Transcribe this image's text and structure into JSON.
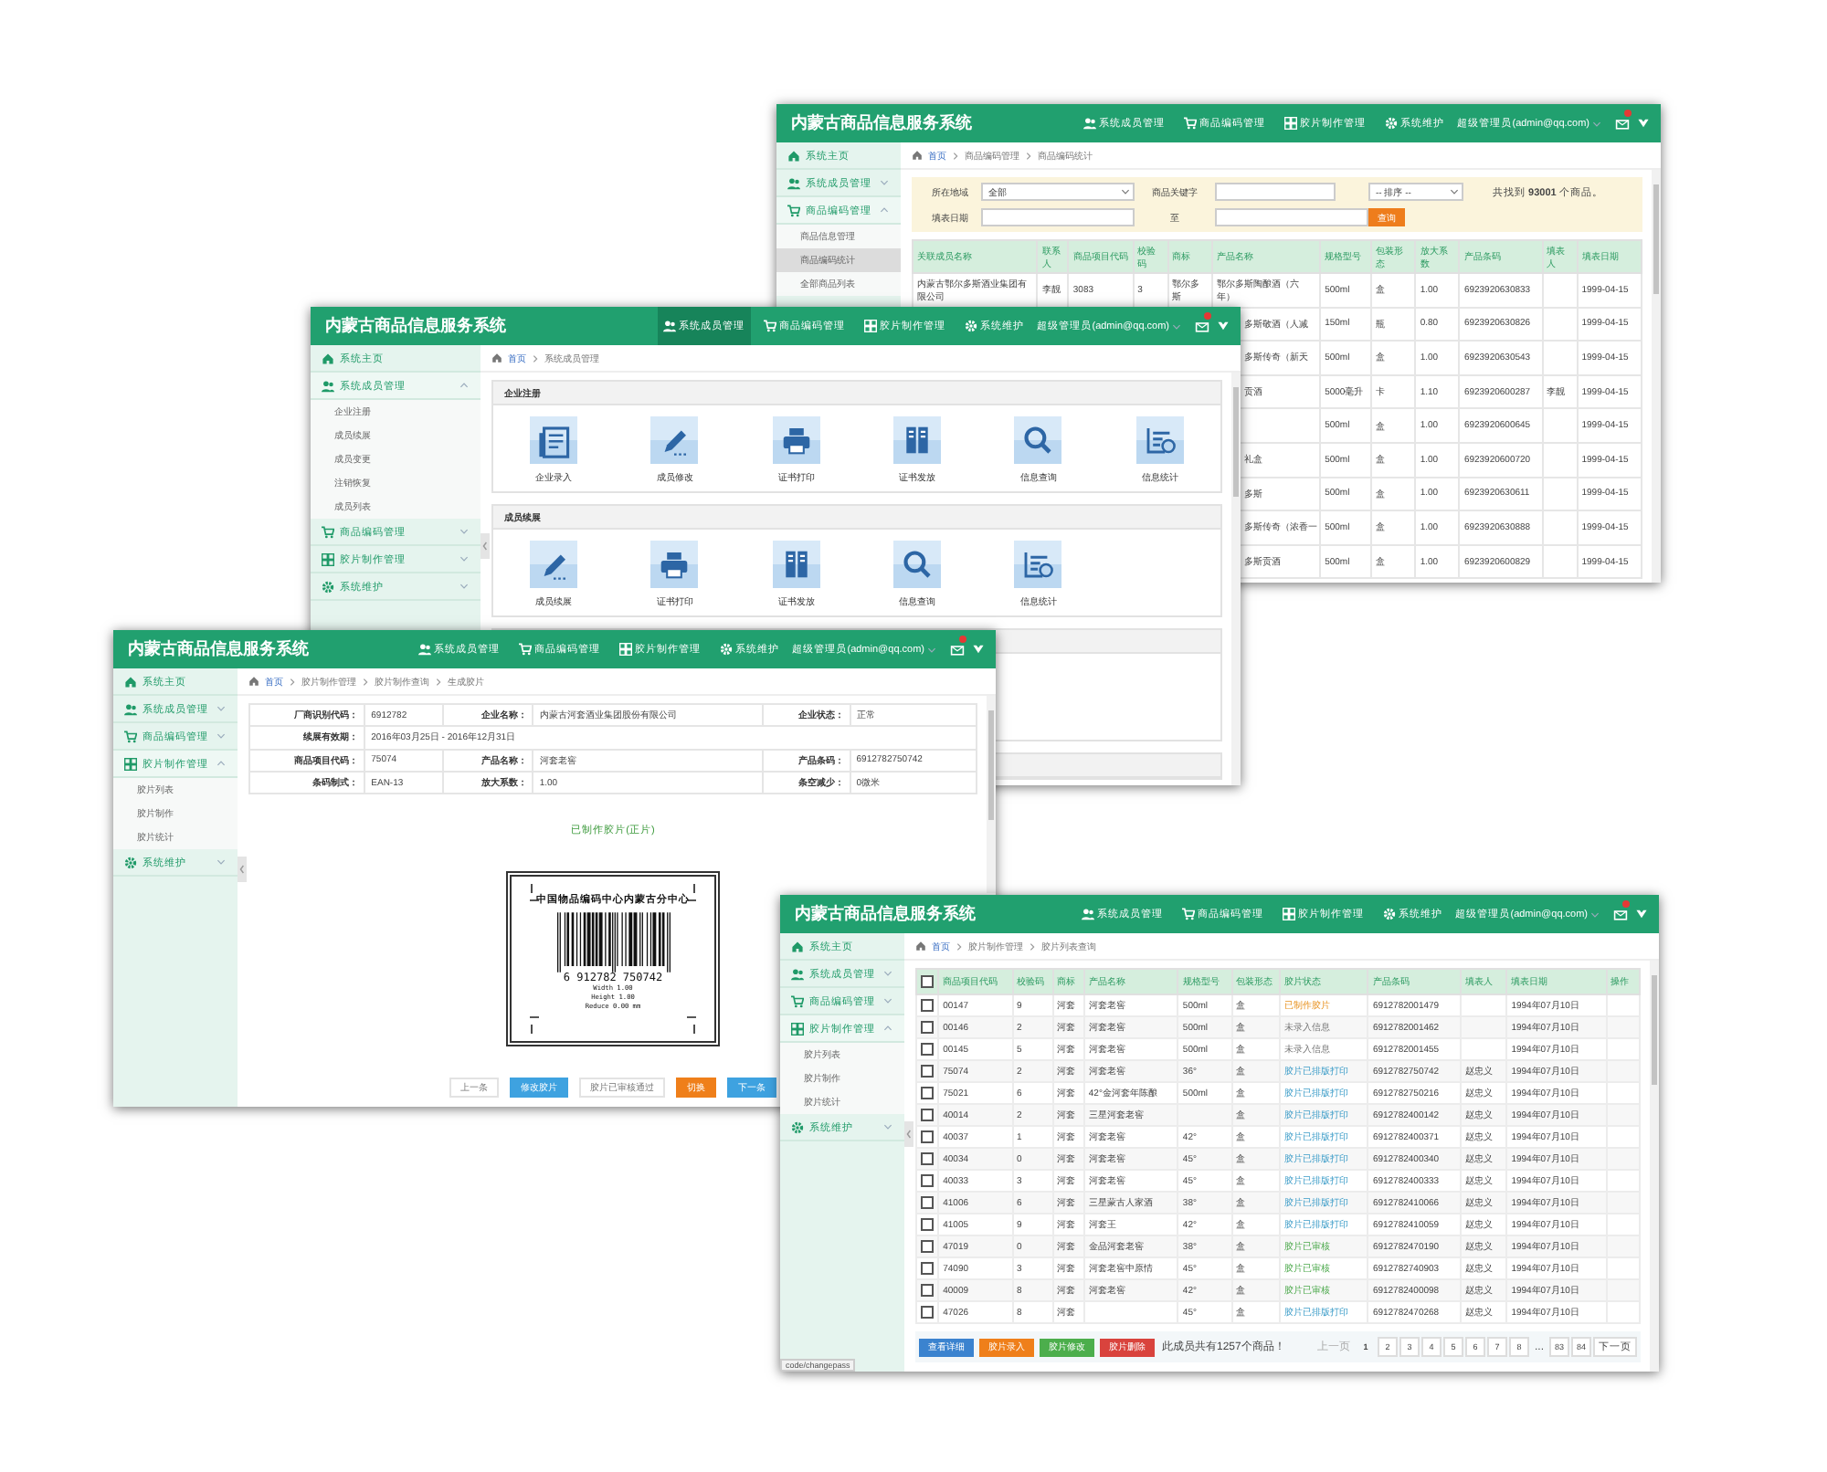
{
  "windows": [
    {
      "kind": "code_stats",
      "title": "内蒙古商品信息服务系统",
      "nav": [
        {
          "label": "系统成员管理",
          "selected": false
        },
        {
          "label": "商品编码管理",
          "selected": false
        },
        {
          "label": "胶片制作管理",
          "selected": false
        },
        {
          "label": "系统维护",
          "selected": false
        }
      ],
      "user": "超级管理员(admin@qq.com)",
      "sidebar": [
        {
          "label": "系统主页"
        },
        {
          "label": "系统成员管理",
          "expanded": false
        },
        {
          "label": "商品编码管理",
          "expanded": true,
          "children": [
            {
              "label": "商品信息管理",
              "selected": false
            },
            {
              "label": "商品编码统计",
              "selected": true
            },
            {
              "label": "全部商品列表",
              "selected": false
            }
          ]
        }
      ],
      "breadcrumb": [
        "首页",
        "商品编码管理",
        "商品编码统计"
      ],
      "filter": {
        "region_label": "所在地域",
        "region_value": "全部",
        "keyword_label": "商品关键字",
        "sort_value": "-- 排序 --",
        "result": "共找到 **93001** 个商品。",
        "date_label": "填表日期",
        "to_label": "至",
        "query": "查询"
      },
      "table": {
        "columns": [
          "关联成员名称",
          "联系人",
          "商品项目代码",
          "校验码",
          "商标",
          "产品名称",
          "规格型号",
          "包装形态",
          "放大系数",
          "产品条码",
          "填表人",
          "填表日期"
        ],
        "rows": [
          {
            "company": "内蒙古鄂尔多斯酒业集团有限公司",
            "contact": "李靓",
            "item_code": "3083",
            "check_digit": "3",
            "brand": "鄂尔多斯",
            "product": "鄂尔多斯陶酿酒（六年）",
            "spec": "500ml",
            "package": "盒",
            "factor": "1.00",
            "barcode": "6923920630833",
            "date": "1999-04-15"
          },
          {
            "product": "多斯敬酒（人减",
            "spec": "150ml",
            "package": "瓶",
            "factor": "0.80",
            "barcode": "6923920630826",
            "date": "1999-04-15"
          },
          {
            "product": "多斯传奇（新天",
            "spec": "500ml",
            "package": "盒",
            "factor": "1.00",
            "barcode": "6923920630543",
            "date": "1999-04-15"
          },
          {
            "product": "贡酒",
            "spec": "5000毫升",
            "package": "卡",
            "factor": "1.10",
            "barcode": "6923920600287",
            "filler": "李靓",
            "date": "1999-04-15"
          },
          {
            "spec": "500ml",
            "package": "盒",
            "factor": "1.00",
            "barcode": "6923920600645",
            "date": "1999-04-15"
          },
          {
            "product": "礼盒",
            "spec": "500ml",
            "package": "盒",
            "factor": "1.00",
            "barcode": "6923920600720",
            "date": "1999-04-15"
          },
          {
            "product": "多斯",
            "spec": "500ml",
            "package": "盒",
            "factor": "1.00",
            "barcode": "6923920630611",
            "date": "1999-04-15"
          },
          {
            "product": "多斯传奇（浓香一",
            "spec": "500ml",
            "package": "盒",
            "factor": "1.00",
            "barcode": "6923920630888",
            "date": "1999-04-15"
          },
          {
            "product": "多斯贡酒",
            "spec": "500ml",
            "package": "盒",
            "factor": "1.00",
            "barcode": "6923920600829",
            "date": "1999-04-15"
          }
        ]
      }
    },
    {
      "kind": "members",
      "title": "内蒙古商品信息服务系统",
      "nav": [
        {
          "label": "系统成员管理",
          "selected": true
        },
        {
          "label": "商品编码管理",
          "selected": false
        },
        {
          "label": "胶片制作管理",
          "selected": false
        },
        {
          "label": "系统维护",
          "selected": false
        }
      ],
      "user": "超级管理员(admin@qq.com)",
      "sidebar": [
        {
          "label": "系统主页"
        },
        {
          "label": "系统成员管理",
          "expanded": true,
          "children": [
            {
              "label": "企业注册",
              "selected": false
            },
            {
              "label": "成员续展",
              "selected": false
            },
            {
              "label": "成员变更",
              "selected": false
            },
            {
              "label": "注销恢复",
              "selected": false
            },
            {
              "label": "成员列表",
              "selected": false
            }
          ]
        },
        {
          "label": "商品编码管理",
          "expanded": false
        },
        {
          "label": "胶片制作管理",
          "expanded": false
        },
        {
          "label": "系统维护",
          "expanded": false
        }
      ],
      "breadcrumb": [
        "首页",
        "系统成员管理"
      ],
      "panels": [
        {
          "title": "企业注册",
          "tiles": [
            {
              "label": "企业录入",
              "kind": "entry"
            },
            {
              "label": "成员修改",
              "kind": "edit"
            },
            {
              "label": "证书打印",
              "kind": "print"
            },
            {
              "label": "证书发放",
              "kind": "issue"
            },
            {
              "label": "信息查询",
              "kind": "search"
            },
            {
              "label": "信息统计",
              "kind": "stats"
            }
          ]
        },
        {
          "title": "成员续展",
          "tiles": [
            {
              "label": "成员续展",
              "kind": "edit"
            },
            {
              "label": "证书打印",
              "kind": "print"
            },
            {
              "label": "证书发放",
              "kind": "issue"
            },
            {
              "label": "信息查询",
              "kind": "search"
            },
            {
              "label": "信息统计",
              "kind": "stats"
            }
          ]
        }
      ]
    },
    {
      "kind": "film_detail",
      "title": "内蒙古商品信息服务系统",
      "nav": [
        {
          "label": "系统成员管理",
          "selected": false
        },
        {
          "label": "商品编码管理",
          "selected": false
        },
        {
          "label": "胶片制作管理",
          "selected": false
        },
        {
          "label": "系统维护",
          "selected": false
        }
      ],
      "user": "超级管理员(admin@qq.com)",
      "sidebar": [
        {
          "label": "系统主页"
        },
        {
          "label": "系统成员管理",
          "expanded": false
        },
        {
          "label": "商品编码管理",
          "expanded": false
        },
        {
          "label": "胶片制作管理",
          "expanded": true,
          "children": [
            {
              "label": "胶片列表",
              "selected": false
            },
            {
              "label": "胶片制作",
              "selected": false
            },
            {
              "label": "胶片统计",
              "selected": false
            }
          ]
        },
        {
          "label": "系统维护",
          "expanded": false
        }
      ],
      "breadcrumb": [
        "首页",
        "胶片制作管理",
        "胶片制作查询",
        "生成胶片"
      ],
      "info": [
        [
          {
            "label": "厂商识别代码：",
            "value": "6912782"
          },
          {
            "label": "企业名称：",
            "value": "内蒙古河套酒业集团股份有限公司"
          },
          {
            "label": "企业状态：",
            "value": "正常"
          }
        ],
        [
          {
            "label": "续展有效期：",
            "value": "2016年03月25日 - 2016年12月31日"
          }
        ],
        [
          {
            "label": "商品项目代码：",
            "value": "75074"
          },
          {
            "label": "产品名称：",
            "value": "河套老窖"
          },
          {
            "label": "产品条码：",
            "value": "6912782750742"
          }
        ],
        [
          {
            "label": "条码制式：",
            "value": "EAN-13"
          },
          {
            "label": "放大系数：",
            "value": "1.00"
          },
          {
            "label": "条空减少：",
            "value": "0微米"
          }
        ]
      ],
      "status": "已制作胶片(正片)",
      "barcode": {
        "header": "中国物品编码中心内蒙古分中心",
        "digits": "6 912782 750742",
        "lines": [
          "Width 1.00",
          "Height 1.00",
          "Reduce 0.00 mm"
        ]
      },
      "buttons": [
        {
          "label": "上一条",
          "kind": "plain"
        },
        {
          "label": "修改胶片",
          "kind": "primary"
        },
        {
          "label": "胶片已审核通过",
          "kind": "plain"
        },
        {
          "label": "切换",
          "kind": "warning"
        },
        {
          "label": "下一条",
          "kind": "primary"
        }
      ]
    },
    {
      "kind": "film_list",
      "title": "内蒙古商品信息服务系统",
      "nav": [
        {
          "label": "系统成员管理",
          "selected": false
        },
        {
          "label": "商品编码管理",
          "selected": false
        },
        {
          "label": "胶片制作管理",
          "selected": false
        },
        {
          "label": "系统维护",
          "selected": false
        }
      ],
      "user": "超级管理员(admin@qq.com)",
      "sidebar": [
        {
          "label": "系统主页"
        },
        {
          "label": "系统成员管理",
          "expanded": false
        },
        {
          "label": "商品编码管理",
          "expanded": false
        },
        {
          "label": "胶片制作管理",
          "expanded": true,
          "children": [
            {
              "label": "胶片列表",
              "selected": false
            },
            {
              "label": "胶片制作",
              "selected": false
            },
            {
              "label": "胶片统计",
              "selected": false
            }
          ]
        },
        {
          "label": "系统维护",
          "expanded": false
        }
      ],
      "breadcrumb": [
        "首页",
        "胶片制作管理",
        "胶片列表查询"
      ],
      "table": {
        "all_checked": false,
        "columns": [
          "商品项目代码",
          "校验码",
          "商标",
          "产品名称",
          "规格型号",
          "包装形态",
          "胶片状态",
          "产品条码",
          "填表人",
          "填表日期",
          "操作"
        ],
        "rows": [
          {
            "checked": false,
            "code": "00147",
            "check": "9",
            "brand": "河套",
            "product": "河套老窖",
            "spec": "500ml",
            "package": "盒",
            "status": "已制作胶片",
            "kind": "made",
            "barcode": "6912782001479",
            "date": "1994年07月10日"
          },
          {
            "checked": false,
            "code": "00146",
            "check": "2",
            "brand": "河套",
            "product": "河套老窖",
            "spec": "500ml",
            "package": "盒",
            "status": "未录入信息",
            "kind": "pending",
            "barcode": "6912782001462",
            "date": "1994年07月10日"
          },
          {
            "checked": false,
            "code": "00145",
            "check": "5",
            "brand": "河套",
            "product": "河套老窖",
            "spec": "500ml",
            "package": "盒",
            "status": "未录入信息",
            "kind": "pending",
            "barcode": "6912782001455",
            "date": "1994年07月10日"
          },
          {
            "checked": false,
            "code": "75074",
            "check": "2",
            "brand": "河套",
            "product": "河套老窖",
            "spec": "36°",
            "package": "盒",
            "status": "胶片已排版打印",
            "kind": "printed",
            "barcode": "6912782750742",
            "filler": "赵忠义",
            "date": "1994年07月10日"
          },
          {
            "checked": false,
            "code": "75021",
            "check": "6",
            "brand": "河套",
            "product": "42°金河套年陈酿",
            "spec": "500ml",
            "package": "盒",
            "status": "胶片已排版打印",
            "kind": "printed",
            "barcode": "6912782750216",
            "filler": "赵忠义",
            "date": "1994年07月10日"
          },
          {
            "checked": false,
            "code": "40014",
            "check": "2",
            "brand": "河套",
            "product": "三星河套老窖",
            "package": "盒",
            "status": "胶片已排版打印",
            "kind": "printed",
            "barcode": "6912782400142",
            "filler": "赵忠义",
            "date": "1994年07月10日"
          },
          {
            "checked": false,
            "code": "40037",
            "check": "1",
            "brand": "河套",
            "product": "河套老窖",
            "spec": "42°",
            "package": "盒",
            "status": "胶片已排版打印",
            "kind": "printed",
            "barcode": "6912782400371",
            "filler": "赵忠义",
            "date": "1994年07月10日"
          },
          {
            "checked": false,
            "code": "40034",
            "check": "0",
            "brand": "河套",
            "product": "河套老窖",
            "spec": "45°",
            "package": "盒",
            "status": "胶片已排版打印",
            "kind": "printed",
            "barcode": "6912782400340",
            "filler": "赵忠义",
            "date": "1994年07月10日"
          },
          {
            "checked": false,
            "code": "40033",
            "check": "3",
            "brand": "河套",
            "product": "河套老窖",
            "spec": "45°",
            "package": "盒",
            "status": "胶片已排版打印",
            "kind": "printed",
            "barcode": "6912782400333",
            "filler": "赵忠义",
            "date": "1994年07月10日"
          },
          {
            "checked": false,
            "code": "41006",
            "check": "6",
            "brand": "河套",
            "product": "三星蒙古人家酒",
            "spec": "38°",
            "package": "盒",
            "status": "胶片已排版打印",
            "kind": "printed",
            "barcode": "6912782410066",
            "filler": "赵忠义",
            "date": "1994年07月10日"
          },
          {
            "checked": false,
            "code": "41005",
            "check": "9",
            "brand": "河套",
            "product": "河套王",
            "spec": "42°",
            "package": "盒",
            "status": "胶片已排版打印",
            "kind": "printed",
            "barcode": "6912782410059",
            "filler": "赵忠义",
            "date": "1994年07月10日"
          },
          {
            "checked": false,
            "code": "47019",
            "check": "0",
            "brand": "河套",
            "product": "金品河套老窖",
            "spec": "38°",
            "package": "盒",
            "status": "胶片已审核",
            "kind": "approved",
            "barcode": "6912782470190",
            "filler": "赵忠义",
            "date": "1994年07月10日"
          },
          {
            "checked": false,
            "code": "74090",
            "check": "3",
            "brand": "河套",
            "product": "河套老窖中原情",
            "spec": "45°",
            "package": "盒",
            "status": "胶片已审核",
            "kind": "approved",
            "barcode": "6912782740903",
            "filler": "赵忠义",
            "date": "1994年07月10日"
          },
          {
            "checked": false,
            "code": "40009",
            "check": "8",
            "brand": "河套",
            "product": "河套老窖",
            "spec": "42°",
            "package": "盒",
            "status": "胶片已审核",
            "kind": "approved",
            "barcode": "6912782400098",
            "filler": "赵忠义",
            "date": "1994年07月10日"
          },
          {
            "checked": false,
            "code": "47026",
            "check": "8",
            "brand": "河套",
            "spec": "45°",
            "package": "盒",
            "status": "胶片已排版打印",
            "kind": "printed",
            "barcode": "6912782470268",
            "filler": "赵忠义",
            "date": "1994年07月10日"
          }
        ]
      },
      "buttons": [
        {
          "label": "查看详细",
          "kind": "primary"
        },
        {
          "label": "胶片录入",
          "kind": "warning"
        },
        {
          "label": "胶片修改",
          "kind": "success"
        },
        {
          "label": "胶片删除",
          "kind": "danger"
        }
      ],
      "summary": "此成员共有1257个商品！",
      "pagination": {
        "prev": "上一页",
        "pages": [
          {
            "label": "1",
            "kind": "page",
            "selected": true
          },
          {
            "label": "2",
            "kind": "page",
            "selected": false
          },
          {
            "label": "3",
            "kind": "page",
            "selected": false
          },
          {
            "label": "4",
            "kind": "page",
            "selected": false
          },
          {
            "label": "5",
            "kind": "page",
            "selected": false
          },
          {
            "label": "6",
            "kind": "page",
            "selected": false
          },
          {
            "label": "7",
            "kind": "page",
            "selected": false
          },
          {
            "label": "8",
            "kind": "page",
            "selected": false
          },
          {
            "label": "...",
            "kind": "gap",
            "selected": false
          },
          {
            "label": "83",
            "kind": "page",
            "selected": false
          },
          {
            "label": "84",
            "kind": "page",
            "selected": false
          }
        ],
        "next": "下一页"
      },
      "status_url": "code/changepass"
    }
  ]
}
